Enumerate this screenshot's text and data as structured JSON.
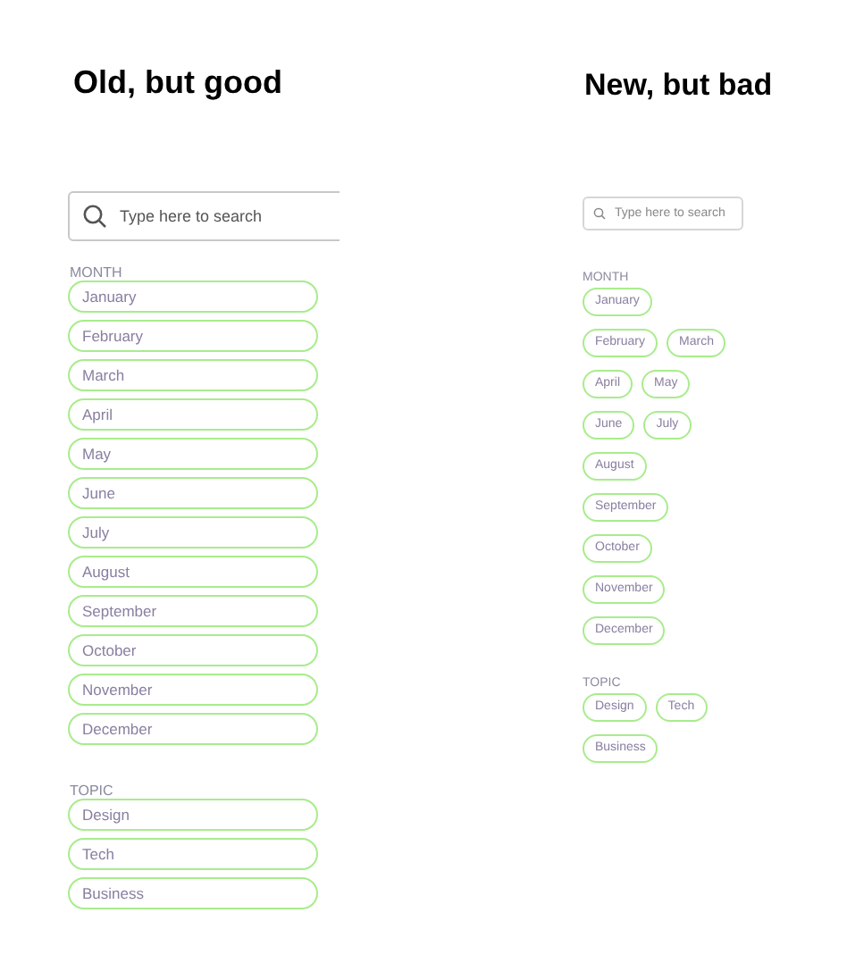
{
  "panels": [
    {
      "kind": "list",
      "title": "Old, but good",
      "search": {
        "placeholder": "Type here to search"
      },
      "groups": [
        {
          "label": "MONTH",
          "rows": [
            [
              "January"
            ],
            [
              "February"
            ],
            [
              "March"
            ],
            [
              "April"
            ],
            [
              "May"
            ],
            [
              "June"
            ],
            [
              "July"
            ],
            [
              "August"
            ],
            [
              "September"
            ],
            [
              "October"
            ],
            [
              "November"
            ],
            [
              "December"
            ]
          ]
        },
        {
          "label": "TOPIC",
          "rows": [
            [
              "Design"
            ],
            [
              "Tech"
            ],
            [
              "Business"
            ]
          ]
        }
      ]
    },
    {
      "kind": "wrap",
      "title": "New, but bad",
      "search": {
        "placeholder": "Type here to search"
      },
      "groups": [
        {
          "label": "MONTH",
          "rows": [
            [
              "January"
            ],
            [
              "February",
              "March"
            ],
            [
              "April",
              "May"
            ],
            [
              "June",
              "July"
            ],
            [
              "August"
            ],
            [
              "September"
            ],
            [
              "October"
            ],
            [
              "November"
            ],
            [
              "December"
            ]
          ]
        },
        {
          "label": "TOPIC",
          "rows": [
            [
              "Design",
              "Tech"
            ],
            [
              "Business"
            ]
          ]
        }
      ]
    }
  ]
}
